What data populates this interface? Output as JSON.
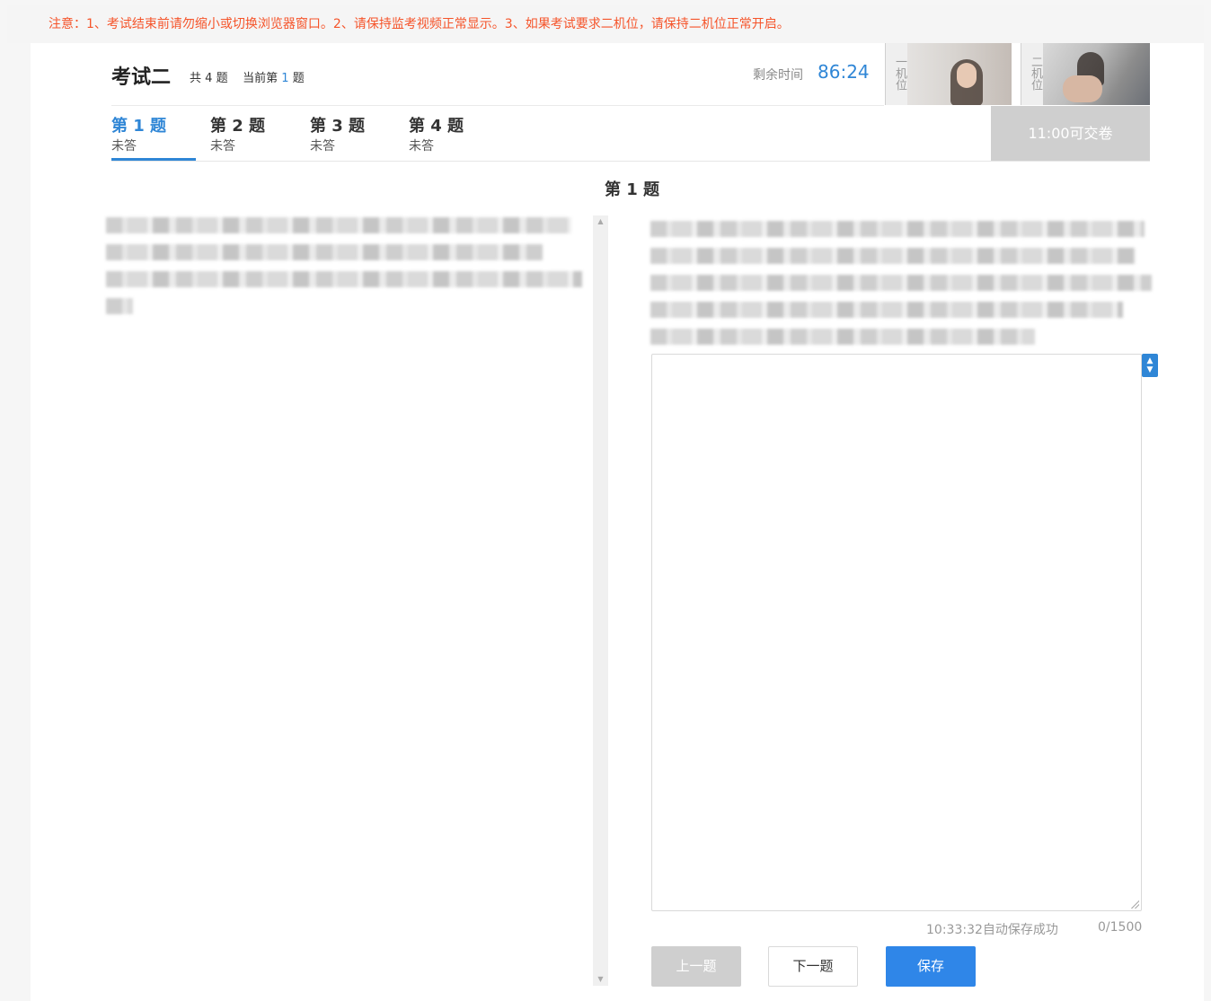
{
  "notice": "注意：1、考试结束前请勿缩小或切换浏览器窗口。2、请保持监考视频正常显示。3、如果考试要求二机位，请保持二机位正常开启。",
  "header": {
    "exam_title": "考试二",
    "total_prefix": "共",
    "total_count": "4",
    "total_suffix": "题",
    "current_prefix": "当前第",
    "current_index": "1",
    "current_suffix": "题",
    "timer_label": "剩余时间",
    "timer_value": "86:24"
  },
  "cameras": [
    {
      "label": "一机位"
    },
    {
      "label": "二机位"
    }
  ],
  "tabs": [
    {
      "label": "第 1 题",
      "status": "未答",
      "active": true
    },
    {
      "label": "第 2 题",
      "status": "未答",
      "active": false
    },
    {
      "label": "第 3 题",
      "status": "未答",
      "active": false
    },
    {
      "label": "第 4 题",
      "status": "未答",
      "active": false
    }
  ],
  "submit_label": "11:00可交卷",
  "question_heading": "第 1 题",
  "answer": {
    "value": "",
    "autosave_text": "10:33:32自动保存成功",
    "char_count": "0/1500"
  },
  "buttons": {
    "prev_label": "上一题",
    "next_label": "下一题",
    "save_label": "保存"
  },
  "colors": {
    "accent": "#2f86d6",
    "notice": "#f5542a",
    "save_button": "#2f86e8",
    "disabled": "#cfcfcf"
  },
  "icons": {
    "scroll_up": "triangle-up-icon",
    "scroll_down": "triangle-down-icon",
    "spinner": "up-down-arrows-icon",
    "resize": "resize-grip-icon"
  }
}
